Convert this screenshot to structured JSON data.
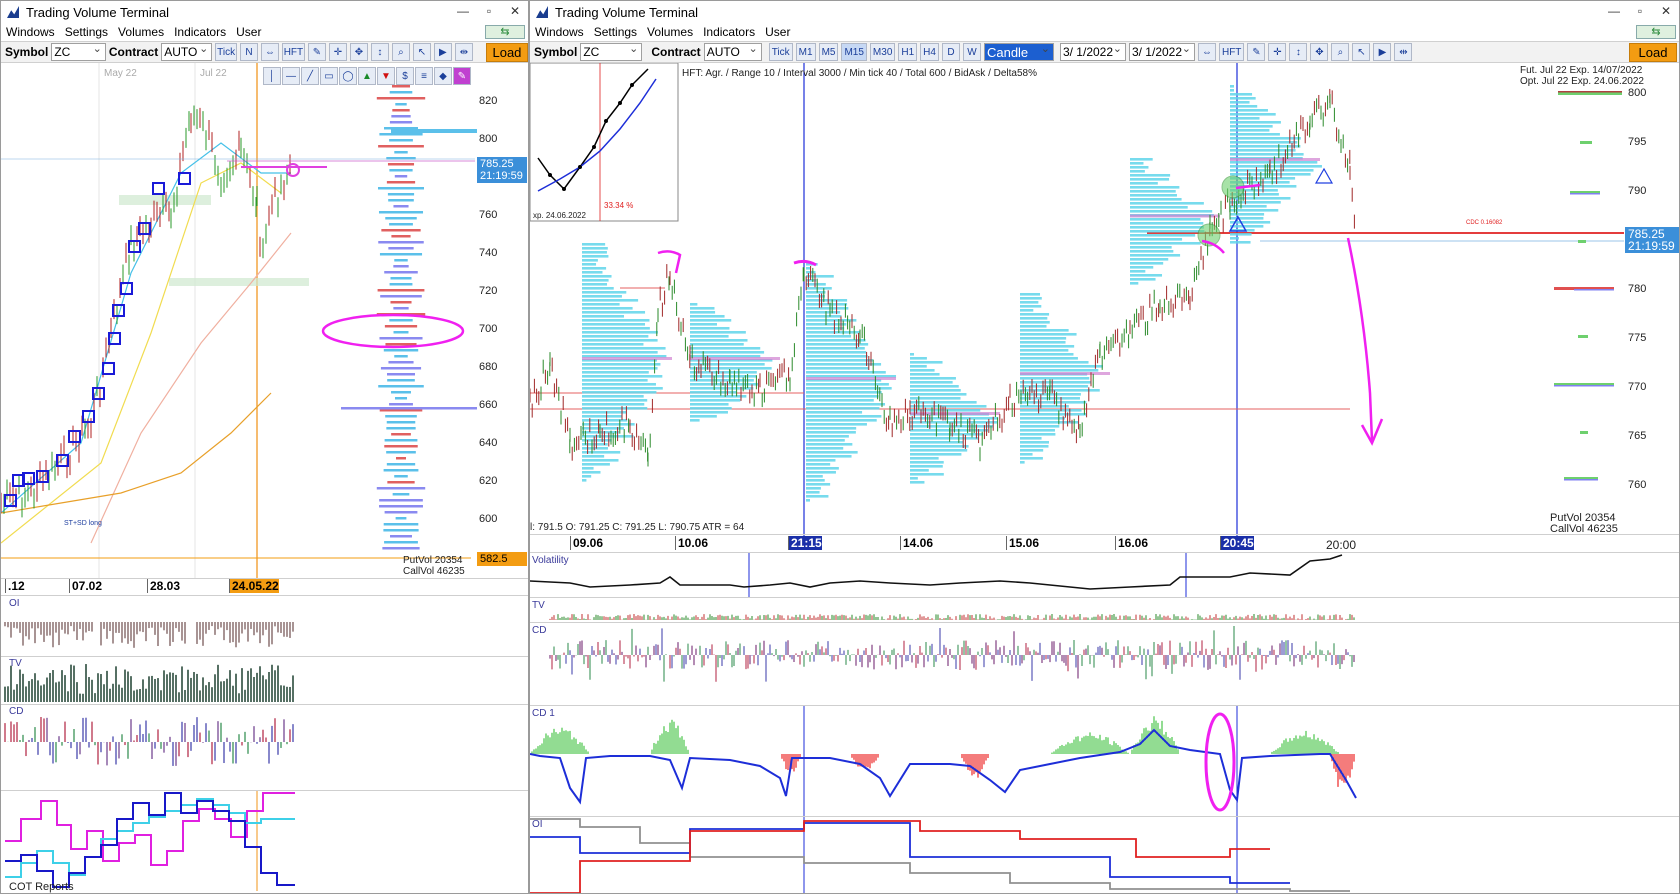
{
  "left_window": {
    "title": "Trading Volume Terminal",
    "menu": [
      "Windows",
      "Settings",
      "Volumes",
      "Indicators",
      "User"
    ],
    "symbol_label": "Symbol",
    "symbol_value": "ZC",
    "contract_label": "Contract",
    "contract_value": "AUTO",
    "buttons": [
      "Tick",
      "N",
      "HFT"
    ],
    "load_label": "Load",
    "top_month_labels": [
      "May 22",
      "Jul 22"
    ],
    "price_axis": [
      "820",
      "800",
      "780",
      "760",
      "740",
      "720",
      "700",
      "680",
      "660",
      "640",
      "620",
      "600"
    ],
    "current_price": "785.25",
    "current_time": "21:19:59",
    "low_tag": "582.5",
    "putvol": "PutVol  20354",
    "callvol": "CallVol  46235",
    "date_labels": [
      ".12",
      "07.02",
      "28.03",
      "24.05.22"
    ],
    "strategy_label": "ST+SD long",
    "panels": [
      "OI",
      "TV",
      "CD",
      "COT Reports"
    ]
  },
  "right_window": {
    "title": "Trading Volume Terminal",
    "menu": [
      "Windows",
      "Settings",
      "Volumes",
      "Indicators",
      "User"
    ],
    "symbol_label": "Symbol",
    "symbol_value": "ZC",
    "contract_label": "Contract",
    "contract_value": "AUTO",
    "timeframes": [
      "Tick",
      "M1",
      "M5",
      "M15",
      "M30",
      "H1",
      "H4",
      "D",
      "W"
    ],
    "chart_type": "Candle",
    "date_from": "3/ 1/2022",
    "date_to": "3/ 1/2022",
    "hft_label": "HFT",
    "load_label": "Load",
    "info_line": "HFT: Agr. / Range 10 / Interval 3000 / Min tick 40 / Total 600 / BidAsk / Delta58%",
    "fut_line": "Fut. Jul 22 Exp. 14/07/2022",
    "opt_line": "Opt. Jul 22 Exp. 24.06.2022",
    "inset_exp": "xp. 24.06.2022",
    "inset_pct": "33.34 %",
    "cdc_label": "CDC 0.16082",
    "price_axis": [
      "800",
      "795",
      "790",
      "785",
      "780",
      "775",
      "770",
      "765",
      "760"
    ],
    "current_price": "785.25",
    "current_time": "21:19:59",
    "ohlc": "l: 791.5   O: 791.25   C: 791.25   L: 790.75   ATR = 64",
    "date_labels": [
      "09.06",
      "10.06",
      "21:15",
      "14.06",
      "15.06",
      "16.06",
      "20:45",
      "20:00"
    ],
    "putvol": "PutVol  20354",
    "callvol": "CallVol  46235",
    "panels": [
      "Volatility",
      "TV",
      "CD",
      "CD 1",
      "OI"
    ]
  }
}
